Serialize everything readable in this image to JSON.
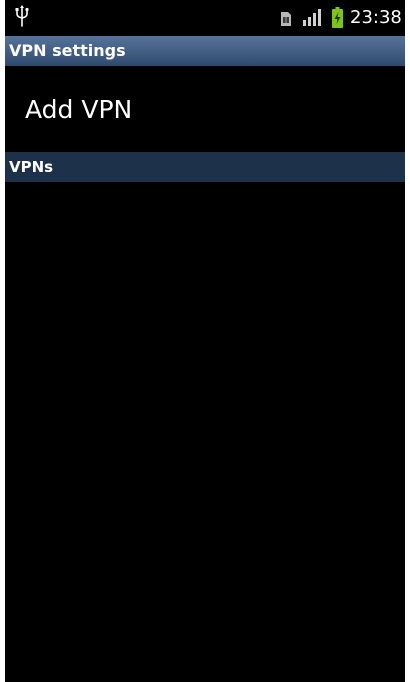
{
  "status_bar": {
    "time": "23:38",
    "icons": [
      "usb-icon",
      "sim-card-icon",
      "signal-strength-icon",
      "battery-charging-icon"
    ],
    "battery_color": "#7ec21a"
  },
  "title_bar": {
    "title": "VPN settings",
    "color": "#3f5a80"
  },
  "add_vpn": {
    "label": "Add VPN"
  },
  "vpn_section": {
    "header": "VPNs",
    "color": "#1d324a",
    "items": []
  }
}
